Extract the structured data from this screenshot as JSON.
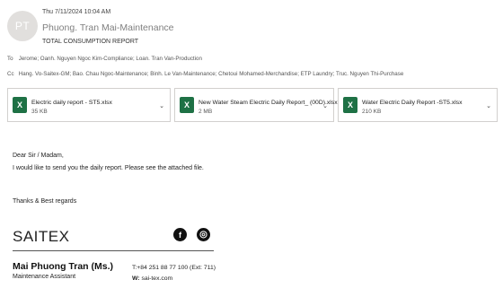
{
  "header": {
    "avatar_initials": "PT",
    "date": "Thu 7/11/2024 10:04 AM",
    "sender": "Phuong. Tran Mai-Maintenance",
    "subject": "TOTAL CONSUMPTION REPORT",
    "to_label": "To",
    "to": "Jerome; Oanh. Nguyen Ngoc Kim-Compliance; Loan. Tran Van-Production",
    "cc_label": "Cc",
    "cc": "Hang. Vo-Saitex-GM; Bao. Chau Ngoc-Maintenance; Binh. Le Van-Maintenance; Chetoui Mohamed-Merchandise; ETP Laundry; Truc. Nguyen Thi-Purchase"
  },
  "attachments": [
    {
      "name": "Electric daily report - ST5.xlsx",
      "size": "35 KB",
      "icon": "excel-icon"
    },
    {
      "name": "New Water Steam Electric Daily Report_ (00D).xlsx",
      "size": "2 MB",
      "icon": "excel-icon"
    },
    {
      "name": "Water Electric Daily Report -ST5.xlsx",
      "size": "210 KB",
      "icon": "excel-icon"
    }
  ],
  "body": {
    "greeting": "Dear Sir / Madam,",
    "line1": "I would like to send you the daily report. Please see  the attached file.",
    "closing": "Thanks & Best regards"
  },
  "signature": {
    "brand": "SAITEX",
    "facebook_glyph": "f",
    "instagram_glyph": "◎",
    "name": "Mai Phuong Tran (Ms.)",
    "title": "Maintenance Assistant",
    "tel": "T:+84 251 88 77 100 (Ext: 711)",
    "web_label": "W:",
    "web": "sai-tex.com"
  },
  "colors": {
    "excel_green": "#1e7145",
    "sender_gray": "#7f7f7f",
    "avatar_bg": "#e1dfdd"
  }
}
